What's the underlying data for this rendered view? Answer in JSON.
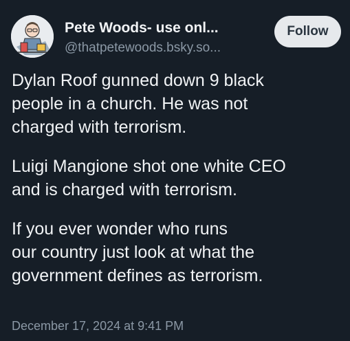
{
  "author": {
    "display_name": "Pete Woods- use onl...",
    "handle": "@thatpetewoods.bsky.so...",
    "avatar_icon": "cartoon-avatar"
  },
  "follow_label": "Follow",
  "post": {
    "paragraphs": [
      {
        "lines": [
          "Dylan Roof gunned down 9 black",
          "people in a church. He was not",
          "charged with terrorism."
        ]
      },
      {
        "lines": [
          "Luigi Mangione shot one white CEO",
          "and is charged with terrorism."
        ]
      },
      {
        "lines": [
          "If you ever wonder who runs",
          "our country just look at what the",
          "government defines as terrorism."
        ]
      }
    ],
    "timestamp": "December 17, 2024 at 9:41 PM"
  },
  "colors": {
    "background": "#161e27",
    "text": "#f1f3f5",
    "muted": "#8b98a5",
    "button_bg": "#e6e9ec"
  }
}
